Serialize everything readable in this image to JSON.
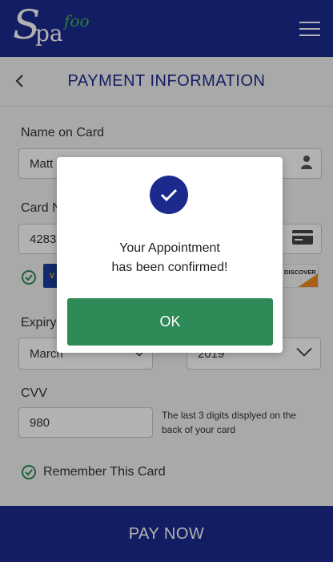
{
  "header": {
    "logo_s": "S",
    "logo_pa": "pa",
    "logo_foo": "foo",
    "menu_icon": "hamburger-menu-icon"
  },
  "subheader": {
    "back_icon": "chevron-left-icon",
    "title": "PAYMENT INFORMATION"
  },
  "form": {
    "name_label": "Name on Card",
    "name_value": "Matt",
    "card_label": "Card N",
    "card_value": "4283",
    "expiry_label": "Expiry",
    "month_value": "March",
    "year_value": "2019",
    "cvv_label": "CVV",
    "cvv_value": "980",
    "cvv_hint": "The last 3 digits displyed on the  back of  your card",
    "remember_label": "Remember This Card",
    "card_logos": [
      "visa",
      "discover"
    ]
  },
  "footer": {
    "pay_label": "PAY NOW"
  },
  "modal": {
    "line1": "Your Appointment",
    "line2": "has been confirmed!",
    "ok_label": "OK"
  },
  "colors": {
    "brand_blue": "#1c2a8e",
    "accent_green": "#2e8b57",
    "logo_green": "#3fb54a"
  }
}
